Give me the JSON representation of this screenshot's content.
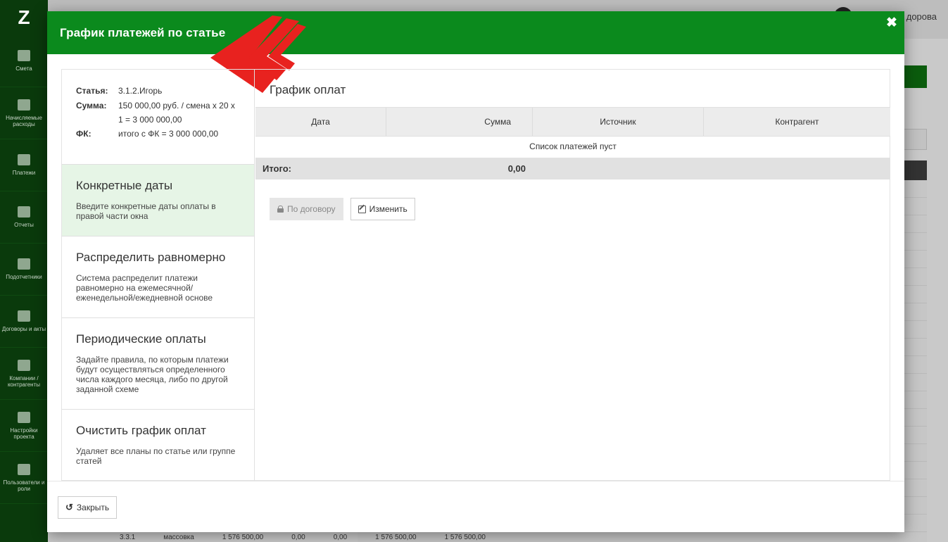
{
  "background": {
    "sidebar_items": [
      {
        "label": "Смета",
        "icon": "book-icon"
      },
      {
        "label": "Начисляемые расходы",
        "icon": "calendar-icon"
      },
      {
        "label": "Платежи",
        "icon": "table-icon"
      },
      {
        "label": "Отчеты",
        "icon": "bar-chart-icon"
      },
      {
        "label": "Подотчетники",
        "icon": "briefcase-icon"
      },
      {
        "label": "Договоры и акты",
        "icon": "list-icon"
      },
      {
        "label": "Компании / контрагенты",
        "icon": "person-icon"
      },
      {
        "label": "Настройки проекта",
        "icon": "sliders-icon"
      },
      {
        "label": "Пользователи и роли",
        "icon": "users-icon"
      }
    ],
    "user_name": "дорова",
    "last_row": {
      "code": "3.3.1",
      "name": "массовка",
      "values": [
        "1 576 500,00",
        "0,00",
        "0,00",
        "1 576 500,00",
        "1 576 500,00"
      ]
    }
  },
  "modal": {
    "title": "График платежей по статье",
    "close_glyph": "✖",
    "info": {
      "article_label": "Статья:",
      "article_value": "3.1.2.Игорь",
      "sum_label": "Сумма:",
      "sum_value": "150 000,00 руб. / смена х 20 х 1 = 3 000 000,00",
      "fk_label": "ФК:",
      "fk_value": "итого с ФК = 3 000 000,00"
    },
    "options": [
      {
        "title": "Конкретные даты",
        "desc": "Введите конкретные даты оплаты в правой части окна"
      },
      {
        "title": "Распределить равномерно",
        "desc": "Система распределит платежи равномерно на ежемесячной/ еженедельной/ежедневной основе"
      },
      {
        "title": "Периодические оплаты",
        "desc": "Задайте правила, по которым платежи будут осуществляться определенного числа каждого месяца, либо по другой заданной схеме"
      },
      {
        "title": "Очистить график оплат",
        "desc": "Удаляет все планы по статье или группе статей"
      }
    ],
    "schedule": {
      "title": "График оплат",
      "columns": [
        "Дата",
        "Сумма",
        "Источник",
        "Контрагент"
      ],
      "empty_text": "Список платежей пуст",
      "total_label": "Итого:",
      "total_value": "0,00"
    },
    "buttons": {
      "by_contract": "По договору",
      "edit": "Изменить",
      "close": "Закрыть"
    },
    "colors": {
      "header": "#0b8a1d",
      "active_option": "#e6f5e6",
      "arrow": "#e8221f"
    }
  }
}
